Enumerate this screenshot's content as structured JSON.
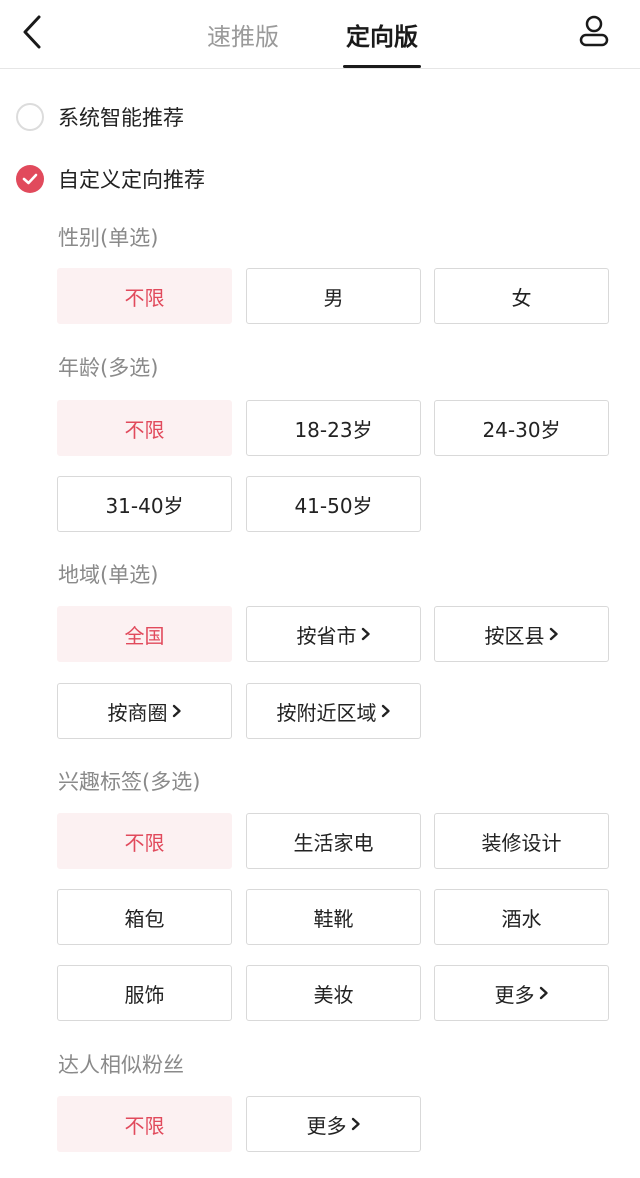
{
  "header": {
    "tabs": [
      "速推版",
      "定向版"
    ],
    "active_tab": "定向版"
  },
  "options": {
    "system": "系统智能推荐",
    "custom": "自定义定向推荐"
  },
  "gender": {
    "title": "性别(单选)",
    "items": [
      "不限",
      "男",
      "女"
    ]
  },
  "age": {
    "title": "年龄(多选)",
    "items": [
      "不限",
      "18-23岁",
      "24-30岁",
      "31-40岁",
      "41-50岁"
    ]
  },
  "region": {
    "title": "地域(单选)",
    "items": [
      "全国",
      "按省市",
      "按区县",
      "按商圈",
      "按附近区域"
    ]
  },
  "interest": {
    "title": "兴趣标签(多选)",
    "items": [
      "不限",
      "生活家电",
      "装修设计",
      "箱包",
      "鞋靴",
      "酒水",
      "服饰",
      "美妆",
      "更多"
    ]
  },
  "fans": {
    "title": "达人相似粉丝",
    "items": [
      "不限",
      "更多"
    ]
  },
  "colors": {
    "accent": "#e14a5c",
    "selected_bg": "#fcf1f2"
  },
  "icons": {
    "back": "chevron-left-icon",
    "profile": "user-icon",
    "check": "check-icon",
    "more": "chevron-right-icon"
  }
}
